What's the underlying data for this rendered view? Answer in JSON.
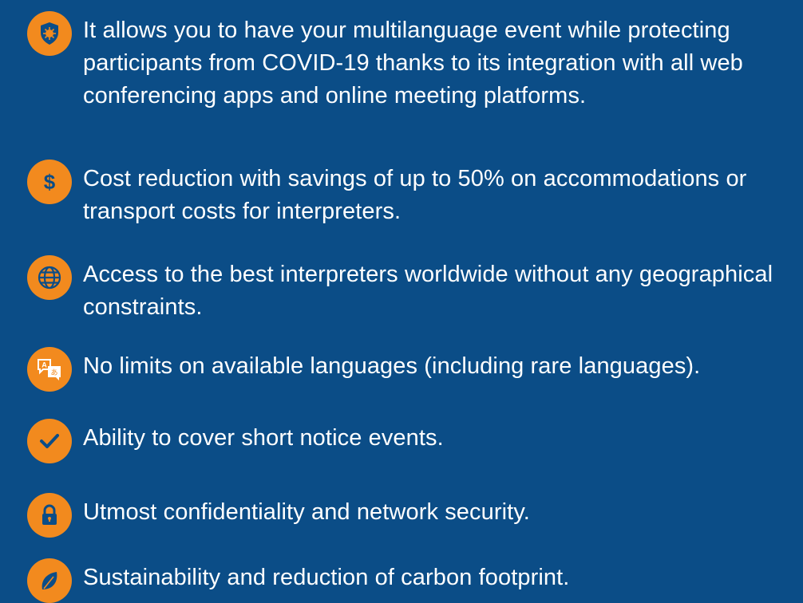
{
  "colors": {
    "background": "#0b4d87",
    "icon_accent": "#f28a1e",
    "text": "#ffffff"
  },
  "items": [
    {
      "icon": "virus-shield-icon",
      "text": "It allows you to have your multilanguage event while protecting participants from COVID-19 thanks to its integration with all web conferencing apps and online meeting platforms."
    },
    {
      "icon": "dollar-icon",
      "text": "Cost reduction with savings of up to 50% on accommodations or transport costs for interpreters."
    },
    {
      "icon": "globe-icon",
      "text": "Access to the best interpreters worldwide without any geographical constraints."
    },
    {
      "icon": "translate-icon",
      "text": "No limits on available languages (including rare languages)."
    },
    {
      "icon": "checkmark-icon",
      "text": "Ability to cover short notice events."
    },
    {
      "icon": "lock-icon",
      "text": "Utmost confidentiality and network security."
    },
    {
      "icon": "leaf-icon",
      "text": "Sustainability and reduction of carbon footprint."
    }
  ]
}
